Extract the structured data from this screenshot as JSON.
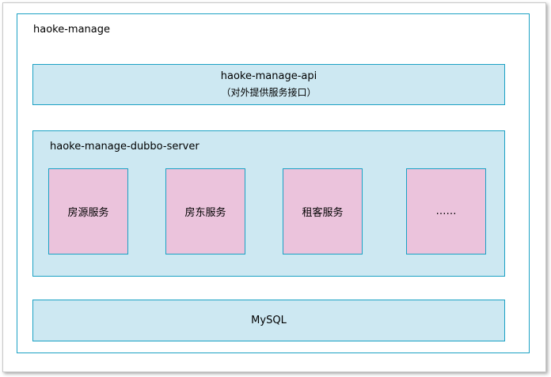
{
  "outer": {
    "title": "haoke-manage"
  },
  "api": {
    "title": "haoke-manage-api",
    "subtitle": "（对外提供服务接口）"
  },
  "server": {
    "title": "haoke-manage-dubbo-server",
    "services": [
      {
        "label": "房源服务"
      },
      {
        "label": "房东服务"
      },
      {
        "label": "租客服务"
      },
      {
        "label": "……"
      }
    ]
  },
  "database": {
    "label": "MySQL"
  },
  "colors": {
    "border": "#1ba1c4",
    "layer_fill": "#cde8f2",
    "service_fill": "#ebc3dc"
  }
}
